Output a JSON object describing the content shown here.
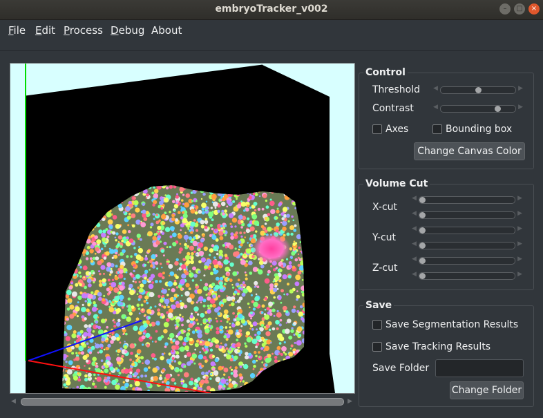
{
  "window": {
    "title": "embryoTracker_v002"
  },
  "menu": [
    {
      "key": "F",
      "rest": "ile"
    },
    {
      "key": "E",
      "rest": "dit"
    },
    {
      "key": "P",
      "rest": "rocess"
    },
    {
      "key": "D",
      "rest": "ebug"
    },
    {
      "key": "",
      "rest": "About"
    }
  ],
  "control": {
    "title": "Control",
    "threshold_label": "Threshold",
    "threshold_value": 0.5,
    "contrast_label": "Contrast",
    "contrast_value": 0.78,
    "axes_label": "Axes",
    "axes_checked": false,
    "bbox_label": "Bounding box",
    "bbox_checked": false,
    "canvas_color_button": "Change Canvas Color"
  },
  "volume_cut": {
    "title": "Volume Cut",
    "x_label": "X-cut",
    "y_label": "Y-cut",
    "z_label": "Z-cut"
  },
  "save": {
    "title": "Save",
    "seg_label": "Save Segmentation Results",
    "track_label": "Save Tracking Results",
    "folder_label": "Save Folder",
    "folder_value": "",
    "change_folder_button": "Change Folder"
  },
  "canvas": {
    "background_color": "#d8ffff",
    "box_color": "#000000"
  },
  "colors": {
    "accent": "#3daee9",
    "window_bg": "#31363b"
  }
}
